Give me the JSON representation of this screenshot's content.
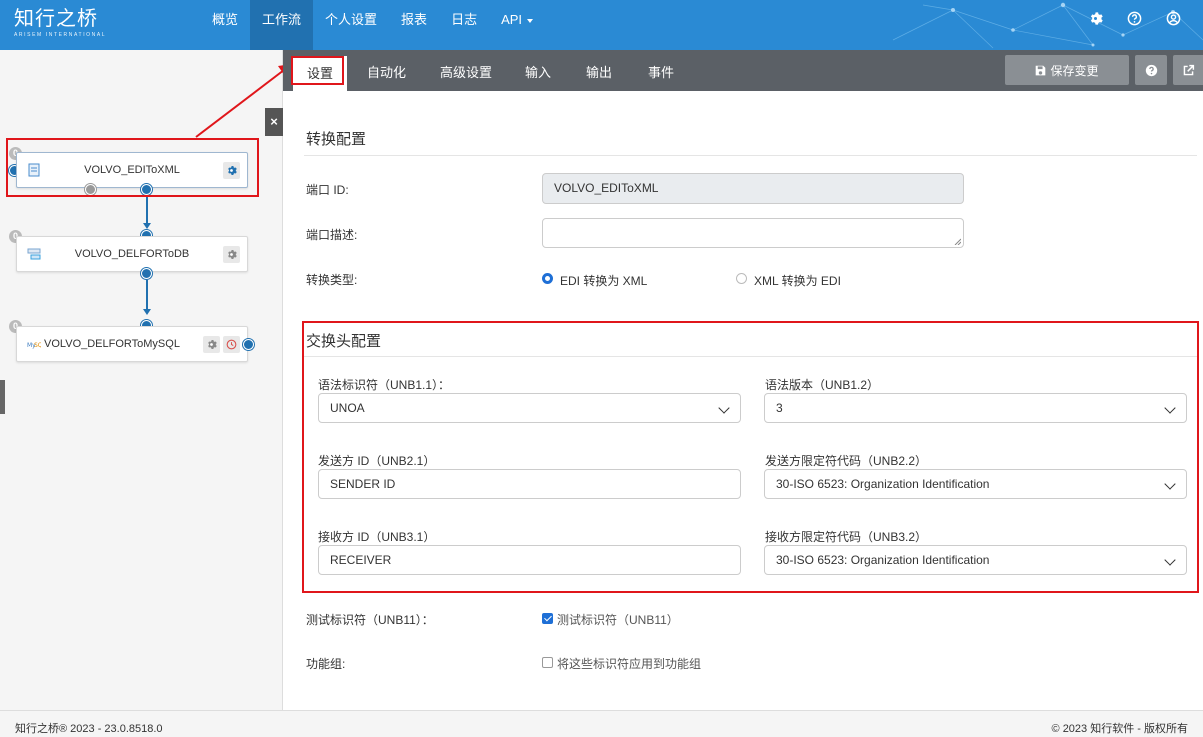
{
  "logo": {
    "brand": "知行之桥",
    "sub": "ARISEM INTERNATIONAL"
  },
  "nav": [
    {
      "label": "概览"
    },
    {
      "label": "工作流",
      "active": true
    },
    {
      "label": "个人设置"
    },
    {
      "label": "报表"
    },
    {
      "label": "日志"
    },
    {
      "label": "API",
      "dropdown": true
    }
  ],
  "top_icons": [
    "gear-icon",
    "help-icon",
    "user-icon"
  ],
  "flow": {
    "nodes": [
      {
        "label": "VOLVO_EDIToXML",
        "badge": "0",
        "icon": "edi-file-icon",
        "selected": true
      },
      {
        "label": "VOLVO_DELFORToDB",
        "badge": "0",
        "icon": "database-icon"
      },
      {
        "label": "VOLVO_DELFORToMySQL",
        "badge": "0",
        "icon": "mysql-icon"
      }
    ],
    "close_label": "×"
  },
  "tabs": [
    {
      "label": "设置",
      "active": true
    },
    {
      "label": "自动化"
    },
    {
      "label": "高级设置"
    },
    {
      "label": "输入"
    },
    {
      "label": "输出"
    },
    {
      "label": "事件"
    }
  ],
  "toolbar": {
    "save_label": "保存变更"
  },
  "conversion": {
    "title": "转换配置",
    "port_id_label": "端口 ID:",
    "port_id_value": "VOLVO_EDIToXML",
    "port_desc_label": "端口描述:",
    "port_desc_value": "",
    "type_label": "转换类型:",
    "type_options": [
      {
        "label": "EDI 转换为 XML",
        "selected": true
      },
      {
        "label": "XML 转换为 EDI",
        "selected": false
      }
    ]
  },
  "interchange": {
    "title": "交换头配置",
    "syntax_id_label": "语法标识符（UNB1.1）：",
    "syntax_id_value": "UNOA",
    "syntax_version_label": "语法版本（UNB1.2）",
    "syntax_version_value": "3",
    "sender_id_label": "发送方 ID（UNB2.1）",
    "sender_id_value": "SENDER ID",
    "sender_qualifier_label": "发送方限定符代码（UNB2.2）",
    "sender_qualifier_value": "30-ISO 6523: Organization Identification",
    "receiver_id_label": "接收方 ID（UNB3.1）",
    "receiver_id_value": "RECEIVER",
    "receiver_qualifier_label": "接收方限定符代码（UNB3.2）",
    "receiver_qualifier_value": "30-ISO 6523: Organization Identification"
  },
  "test_indicator": {
    "label": "测试标识符（UNB11）：",
    "checkbox_label": "测试标识符（UNB11）",
    "checked": true
  },
  "functional_group": {
    "label": "功能组:",
    "checkbox_label": "将这些标识符应用到功能组",
    "checked": false
  },
  "footer": {
    "left": "知行之桥® 2023 - 23.0.8518.0",
    "right": "© 2023 知行软件 - 版权所有"
  },
  "colors": {
    "topbar": "#2a8ad4",
    "nav_active": "#2171b0",
    "tabbar": "#5b6066",
    "annotation": "#e0161b",
    "accent": "#1e6fd6"
  }
}
